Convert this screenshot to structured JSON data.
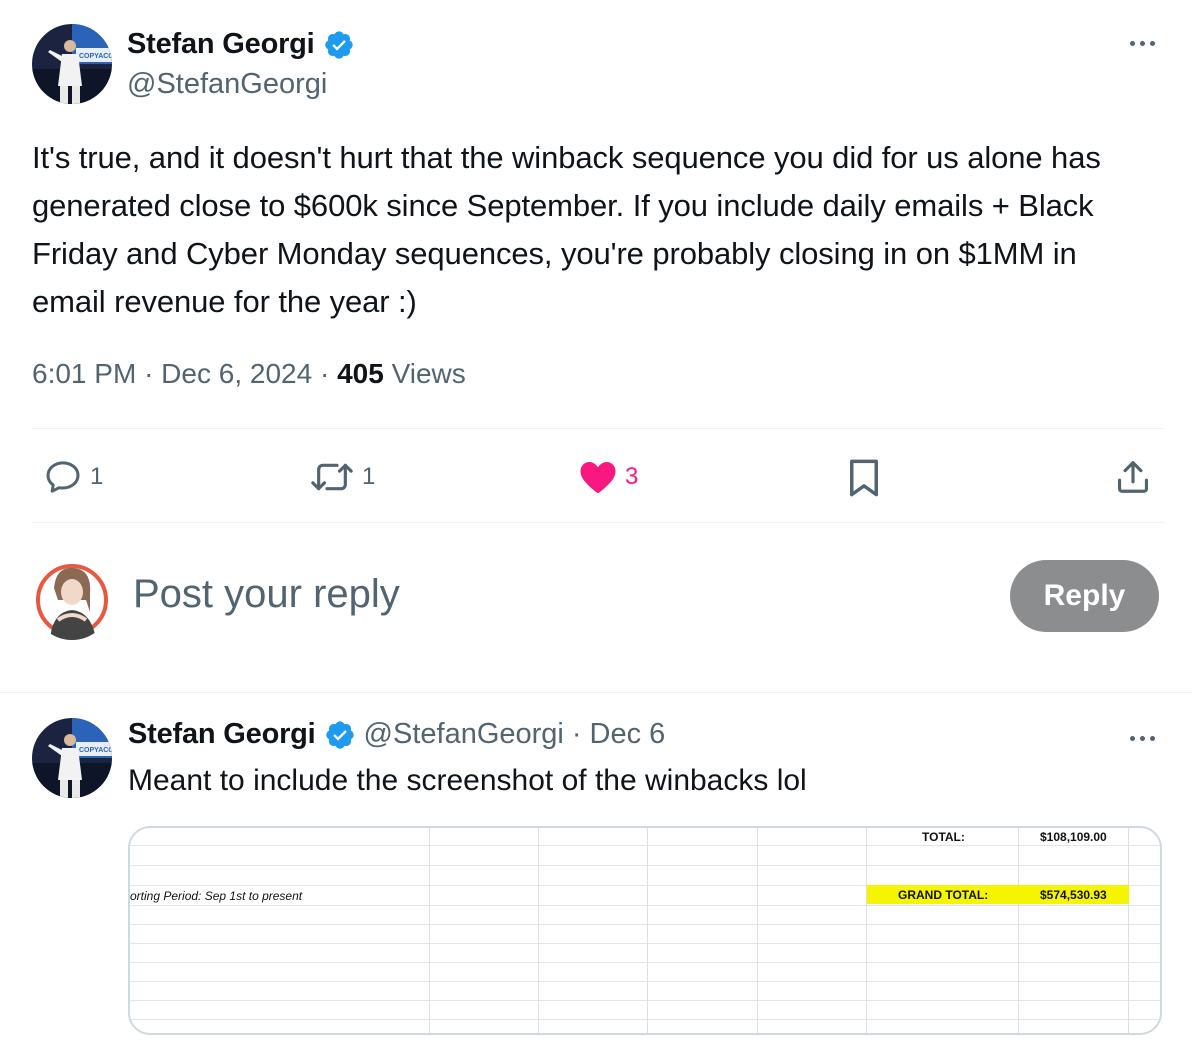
{
  "main_tweet": {
    "author_name": "Stefan Georgi",
    "author_handle": "@StefanGeorgi",
    "text": "It's true, and it doesn't hurt that the winback sequence you did for us alone has generated close to $600k since September. If you include daily emails + Black Friday and Cyber Monday sequences, you're probably closing in on $1MM in email revenue for the year :)",
    "time": "6:01 PM",
    "date": "Dec 6, 2024",
    "views_count": "405",
    "views_label": "Views",
    "separator": "·"
  },
  "actions": {
    "reply_count": "1",
    "repost_count": "1",
    "like_count": "3"
  },
  "reply_box": {
    "placeholder": "Post your reply",
    "button_label": "Reply"
  },
  "reply_tweet": {
    "author_name": "Stefan Georgi",
    "author_handle": "@StefanGeorgi",
    "separator": "·",
    "date": "Dec 6",
    "text": "Meant to include the screenshot of the winbacks lol"
  },
  "spreadsheet": {
    "period_label": "orting Period: Sep 1st to present",
    "total_label": "TOTAL:",
    "total_value": "$108,109.00",
    "grand_total_label": "GRAND TOTAL:",
    "grand_total_value": "$574,530.93",
    "highlight_color": "#f5f500"
  },
  "colors": {
    "verified": "#1d9bf0",
    "like": "#f91880",
    "muted": "#536471",
    "reply_button": "#8b8d8f"
  }
}
